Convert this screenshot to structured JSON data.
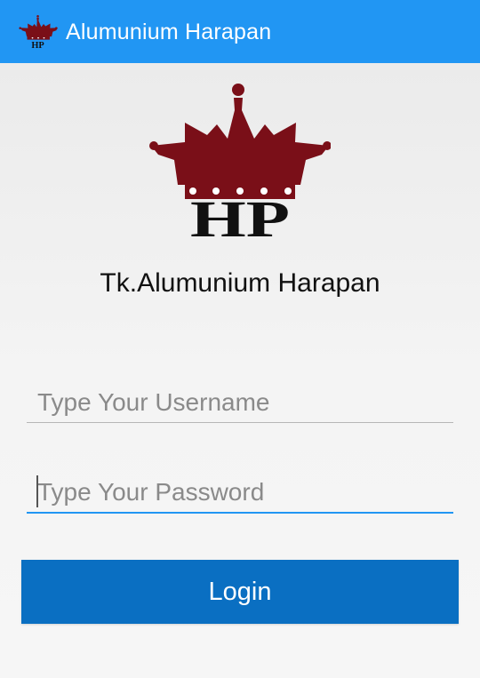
{
  "appbar": {
    "title": "Alumunium Harapan",
    "logo_icon": "crown-hp-logo-icon",
    "background_color": "#2196f3"
  },
  "logo": {
    "icon": "crown-hp-logo-icon",
    "monogram": "HP",
    "crown_color": "#7a0f18"
  },
  "shop": {
    "name": "Tk.Alumunium Harapan"
  },
  "form": {
    "username_placeholder": "Type Your Username",
    "password_placeholder": "Type Your Password",
    "login_label": "Login",
    "accent_color": "#2196f3",
    "button_color": "#0a6fc2"
  }
}
